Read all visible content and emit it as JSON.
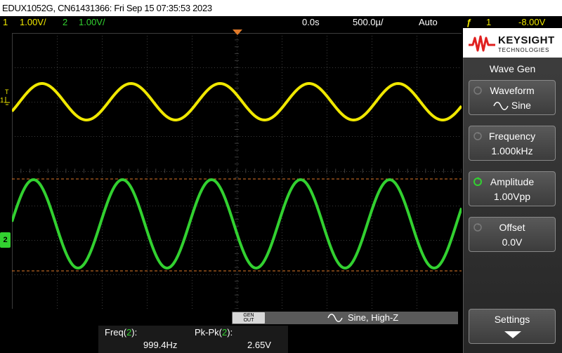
{
  "header": {
    "title": "EDUX1052G, CN61431366: Fri Sep 15 07:35:53 2023"
  },
  "status": {
    "ch1_num": "1",
    "ch1_scale": "1.00V/",
    "ch2_num": "2",
    "ch2_scale": "1.00V/",
    "time_pos": "0.0s",
    "time_scale": "500.0µ/",
    "trigger_mode": "Auto",
    "trigger_symbol": "ƒ",
    "trigger_ch": "1",
    "trigger_level": "-8.00V"
  },
  "screen": {
    "ch1_marker": "1",
    "trig_marker": "T",
    "ch2_marker": "2"
  },
  "colors": {
    "ch1": "#f0e800",
    "ch2": "#32d130",
    "cursor": "#e07a2a",
    "grid": "#3c3c3c",
    "brand_red": "#e0201f"
  },
  "panel": {
    "brand": "KEYSIGHT",
    "brand_sub": "TECHNOLOGIES",
    "title": "Wave Gen",
    "waveform_label": "Waveform",
    "waveform_value": "Sine",
    "frequency_label": "Frequency",
    "frequency_value": "1.000kHz",
    "amplitude_label": "Amplitude",
    "amplitude_value": "1.00Vpp",
    "offset_label": "Offset",
    "offset_value": "0.0V",
    "settings_label": "Settings"
  },
  "gen": {
    "out_label_1": "GEN",
    "out_label_2": "OUT",
    "status": "Sine, High-Z"
  },
  "measurements": {
    "freq_label": "Freq(",
    "freq_ch": "2",
    "freq_close": "):",
    "freq_value": "999.4Hz",
    "pkpk_label": "Pk-Pk(",
    "pkpk_ch": "2",
    "pkpk_close": "):",
    "pkpk_value": "2.65V"
  },
  "icons": {
    "sine": "sine-wave-icon",
    "knob": "knob-icon",
    "arrow": "arrow-down-icon",
    "logo": "keysight-logo"
  }
}
